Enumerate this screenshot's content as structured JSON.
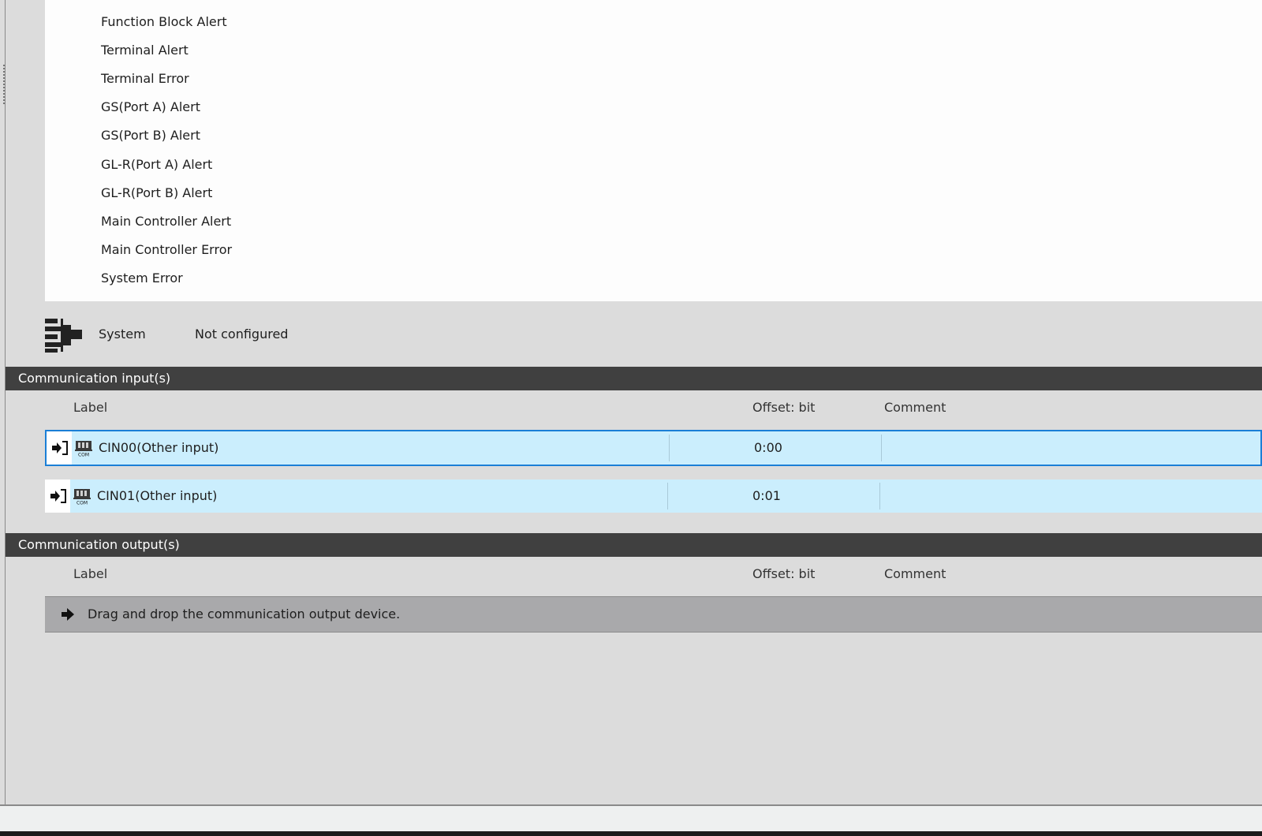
{
  "alert_list": {
    "items": [
      "Function Block Alert",
      "Terminal Alert",
      "Terminal Error",
      "GS(Port A) Alert",
      "GS(Port B) Alert",
      "GL-R(Port A) Alert",
      "GL-R(Port B) Alert",
      "Main Controller Alert",
      "Main Controller Error",
      "System Error"
    ]
  },
  "system": {
    "label": "System",
    "value": "Not configured",
    "icon": "system-block-icon"
  },
  "comm_inputs": {
    "header": "Communication input(s)",
    "columns": {
      "label": "Label",
      "offset": "Offset: bit",
      "comment": "Comment"
    },
    "rows": [
      {
        "label": "CIN00(Other input)",
        "offset": "0:00",
        "comment": "",
        "selected": true
      },
      {
        "label": "CIN01(Other input)",
        "offset": "0:01",
        "comment": "",
        "selected": false
      }
    ]
  },
  "comm_outputs": {
    "header": "Communication output(s)",
    "columns": {
      "label": "Label",
      "offset": "Offset: bit",
      "comment": "Comment"
    },
    "drop_hint": "Drag and drop the communication output device."
  },
  "colors": {
    "header_bg": "#404040",
    "row_bg": "#cbeefd",
    "selected_border": "#1b7fd6",
    "drop_zone_bg": "#a9a9ab",
    "panel_bg": "#dcdcdc"
  }
}
